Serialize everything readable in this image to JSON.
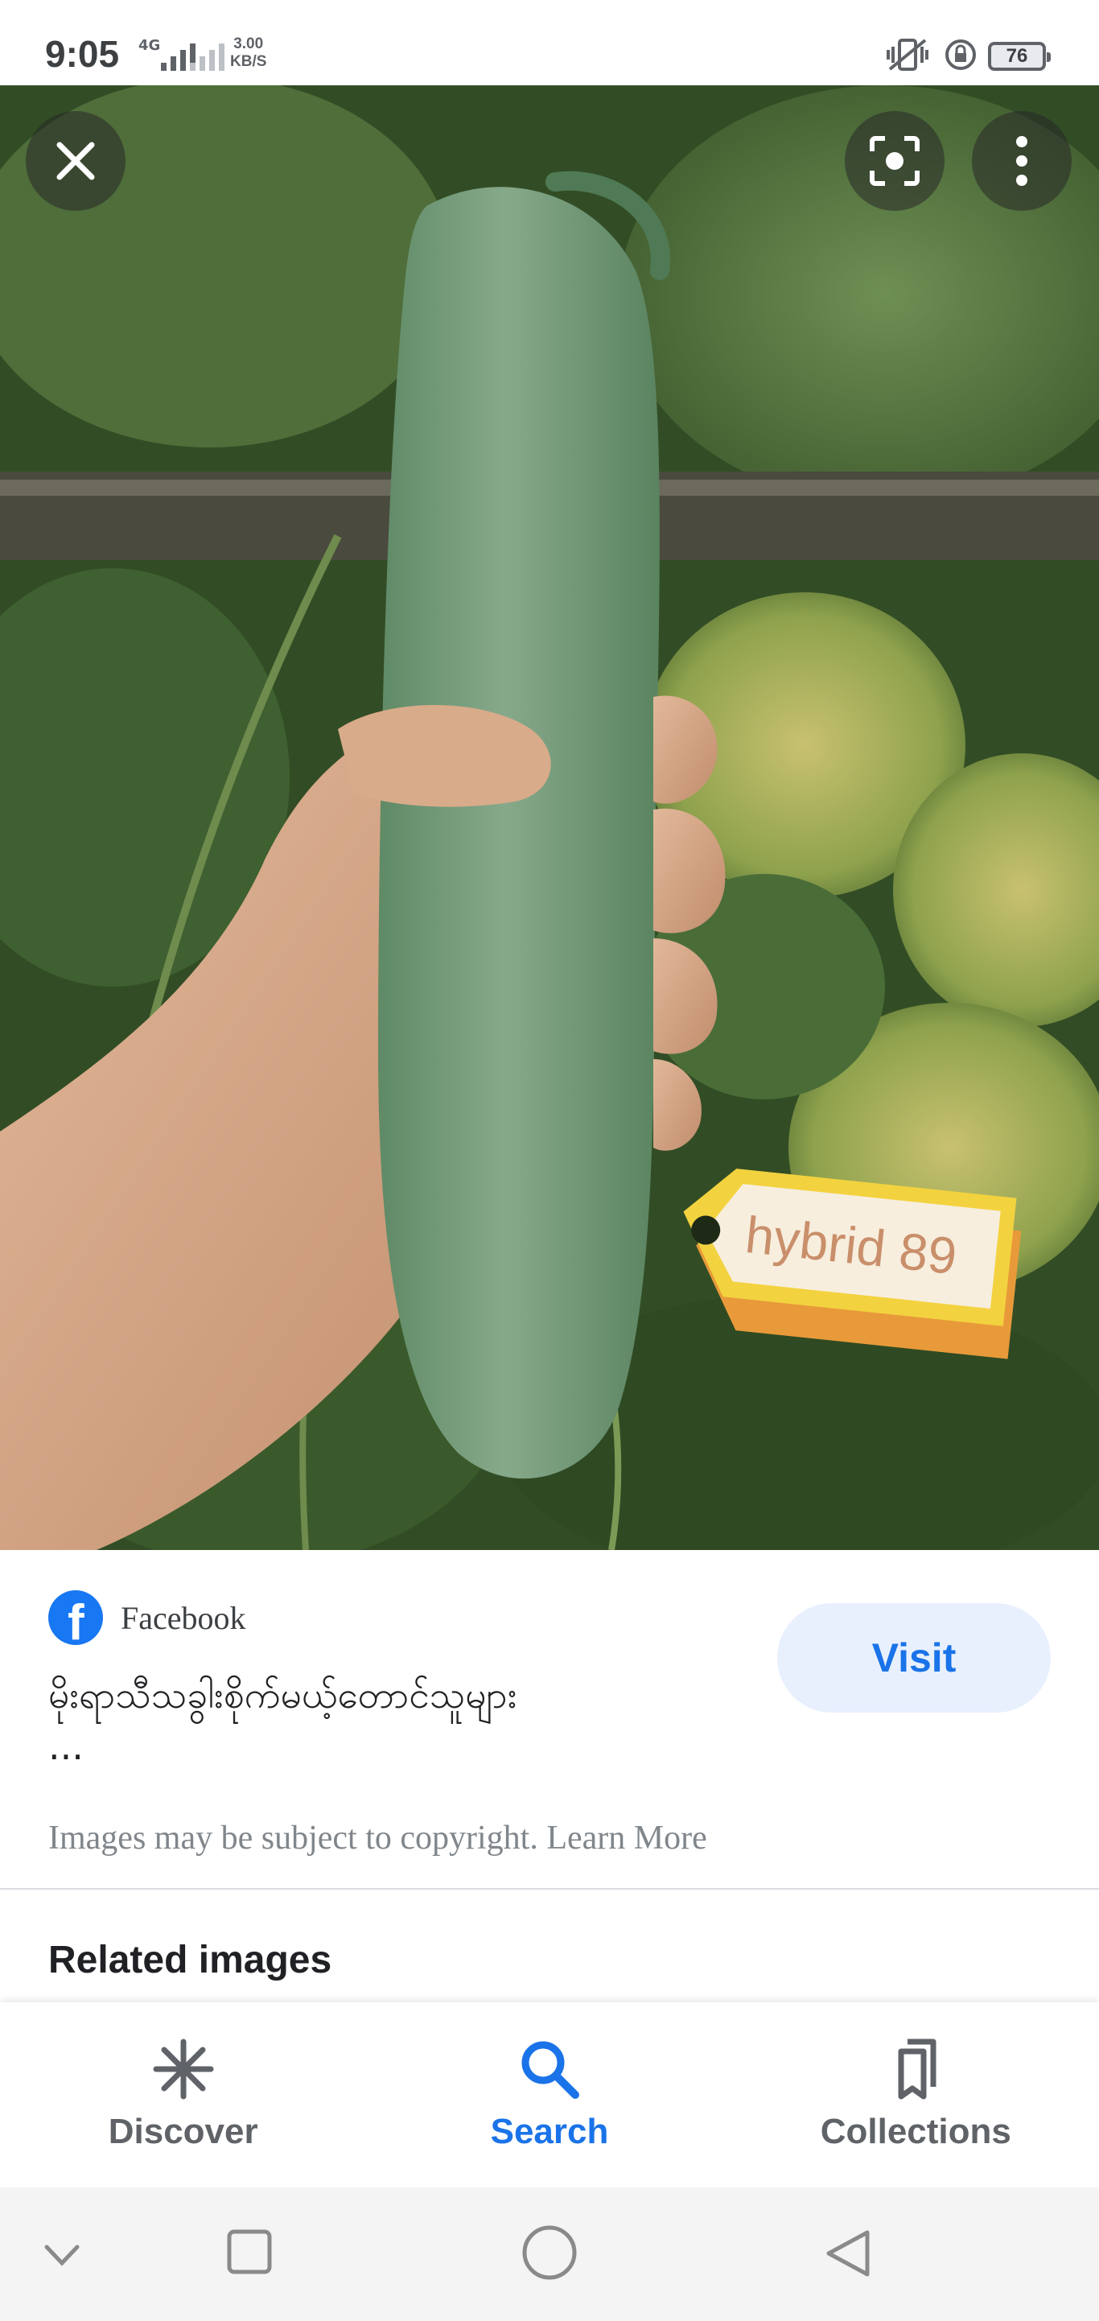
{
  "status_bar": {
    "time": "9:05",
    "network": "4G",
    "speed_value": "3.00",
    "speed_unit": "KB/S",
    "battery": "76"
  },
  "viewer": {
    "tag_text": "hybrid 89",
    "icons": {
      "close": "close-icon",
      "lens": "lens-icon",
      "more": "more-vert-icon"
    }
  },
  "result": {
    "source": "Facebook",
    "title": "မိုးရာသီသခွါးစိုက်မယ့်တောင်သူများ",
    "title_ellipsis": "...",
    "visit_label": "Visit",
    "copyright_text": "Images may be subject to copyright.",
    "learn_more": "Learn More"
  },
  "related_heading": "Related images",
  "bottom_nav": {
    "items": [
      {
        "label": "Discover",
        "icon": "asterisk-icon",
        "active": false
      },
      {
        "label": "Search",
        "icon": "search-icon",
        "active": true
      },
      {
        "label": "Collections",
        "icon": "bookmarks-icon",
        "active": false
      }
    ]
  },
  "system_nav": [
    "collapse-chevron-icon",
    "recents-square-icon",
    "home-circle-icon",
    "back-triangle-icon"
  ],
  "colors": {
    "accent": "#1a73e8",
    "visit_bg": "#e8f0fe",
    "facebook": "#1877f2"
  }
}
